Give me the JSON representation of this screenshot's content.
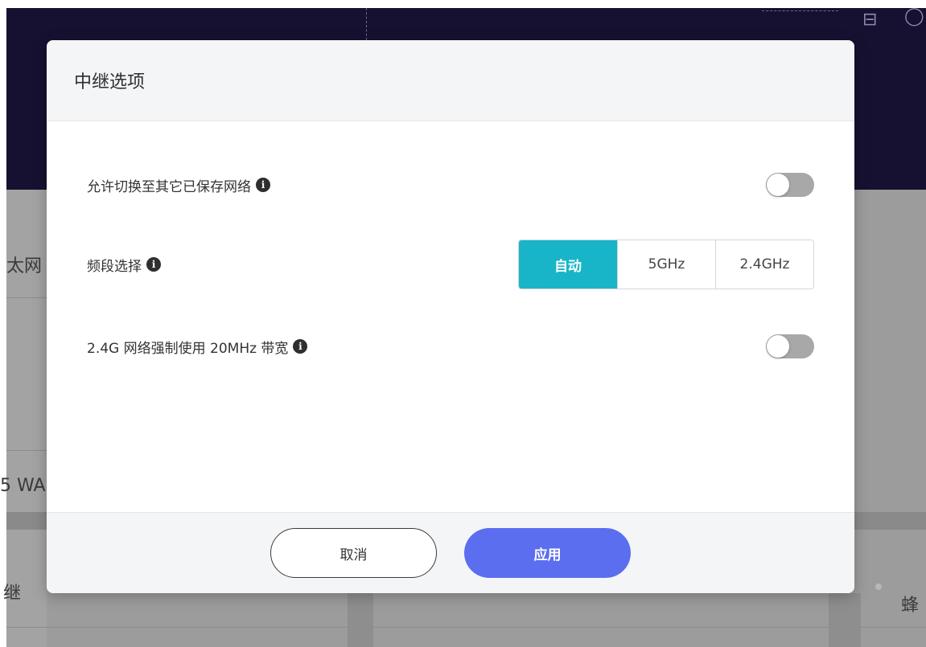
{
  "background": {
    "partial_texts": [
      "太网",
      "5 WA",
      "继",
      "蜂"
    ]
  },
  "dialog": {
    "title": "中继选项",
    "rows": [
      {
        "label": "允许切换至其它已保存网络",
        "control": "toggle",
        "on": false,
        "info_icon": "info-icon"
      },
      {
        "label": "频段选择",
        "control": "segmented",
        "info_icon": "info-icon",
        "options": [
          "自动",
          "5GHz",
          "2.4GHz"
        ],
        "selected": "自动"
      },
      {
        "label": "2.4G 网络强制使用 20MHz 带宽",
        "control": "toggle",
        "on": false,
        "info_icon": "info-icon"
      }
    ],
    "footer": {
      "cancel_label": "取消",
      "apply_label": "应用"
    }
  },
  "colors": {
    "accent_teal": "#18b5c8",
    "apply_blue": "#5b6ef0",
    "toggle_off": "#a8a8a8",
    "header_dark": "#161131"
  }
}
